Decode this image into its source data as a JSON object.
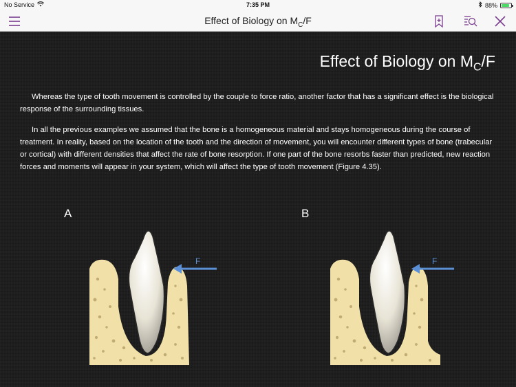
{
  "status_bar": {
    "carrier": "No Service",
    "time": "7:35 PM",
    "battery_percent": "88%",
    "battery_level": 0.88
  },
  "nav": {
    "title_main": "Effect of Biology on M",
    "title_sub": "C",
    "title_tail": "/F",
    "menu_icon": "hamburger-icon",
    "bookmark_icon": "bookmark-icon",
    "search_icon": "search-list-icon",
    "close_icon": "close-icon",
    "accent_color": "#7a3d8f"
  },
  "page": {
    "title_main": "Effect of Biology on M",
    "title_sub": "C",
    "title_tail": "/F",
    "paragraph1": "Whereas the type of tooth movement is controlled by the couple to force ratio, another factor that has a significant effect is the biological response of the surrounding tissues.",
    "paragraph2": "In all the previous examples we assumed that the bone is a homogeneous material and stays homogeneous during the course of treatment. In reality, based on the location of the tooth and the direction of movement, you will encounter different types of bone (trabecular or cortical) with different densities that affect the rate of bone resorption. If one part of the bone resorbs faster than predicted, new reaction forces and moments will appear in your system, which will affect the type of tooth movement (Figure 4.35)."
  },
  "figures": [
    {
      "label": "A",
      "force_label": "F"
    },
    {
      "label": "B",
      "force_label": "F"
    }
  ],
  "colors": {
    "bone": "#f1e1a8",
    "arrow": "#5b8fd6",
    "tooth": "#ece8dc"
  }
}
